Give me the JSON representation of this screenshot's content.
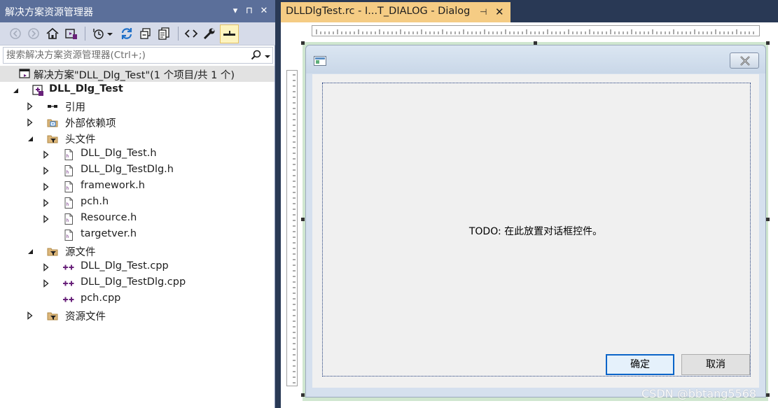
{
  "solution_explorer": {
    "title": "解决方案资源管理器",
    "title_buttons": [
      "▾",
      "⊓",
      "✕"
    ],
    "search_placeholder": "搜索解决方案资源管理器(Ctrl+;)",
    "tree": [
      {
        "label": "解决方案\"DLL_Dlg_Test\"(1 个项目/共 1 个)",
        "icon": "solution-icon",
        "expander": "none",
        "selected": true
      },
      {
        "label": "DLL_Dlg_Test",
        "icon": "project-icon",
        "expander": "expanded",
        "bold": true
      },
      {
        "label": "引用",
        "icon": "references-icon",
        "expander": "collapsed"
      },
      {
        "label": "外部依赖项",
        "icon": "external-deps-icon",
        "expander": "collapsed"
      },
      {
        "label": "头文件",
        "icon": "filter-folder-icon",
        "expander": "expanded"
      },
      {
        "label": "DLL_Dlg_Test.h",
        "icon": "header-file-icon",
        "expander": "collapsed"
      },
      {
        "label": "DLL_Dlg_TestDlg.h",
        "icon": "header-file-icon",
        "expander": "collapsed"
      },
      {
        "label": "framework.h",
        "icon": "header-file-icon",
        "expander": "collapsed"
      },
      {
        "label": "pch.h",
        "icon": "header-file-icon",
        "expander": "collapsed"
      },
      {
        "label": "Resource.h",
        "icon": "header-file-icon",
        "expander": "collapsed"
      },
      {
        "label": "targetver.h",
        "icon": "header-file-icon",
        "expander": "none"
      },
      {
        "label": "源文件",
        "icon": "filter-folder-icon",
        "expander": "expanded"
      },
      {
        "label": "DLL_Dlg_Test.cpp",
        "icon": "cpp-file-icon",
        "expander": "collapsed"
      },
      {
        "label": "DLL_Dlg_TestDlg.cpp",
        "icon": "cpp-file-icon",
        "expander": "collapsed"
      },
      {
        "label": "pch.cpp",
        "icon": "cpp-file-icon",
        "expander": "none"
      },
      {
        "label": "资源文件",
        "icon": "filter-folder-icon",
        "expander": "collapsed"
      }
    ]
  },
  "document_tab": {
    "title": "DLLDlgTest.rc - I...T_DIALOG - Dialog",
    "pin_glyph": "⊣",
    "close_glyph": "✕"
  },
  "dialog": {
    "todo_text": "TODO: 在此放置对话框控件。",
    "ok_label": "确定",
    "cancel_label": "取消"
  },
  "watermark": "CSDN @bbtang5568",
  "colors": {
    "title_bar": "#5b6f9a",
    "toolbar": "#d6dbe9",
    "active_tab": "#f5cc84",
    "design_surface": "#cfe6cf",
    "selection_row": "#e2e2e2"
  }
}
